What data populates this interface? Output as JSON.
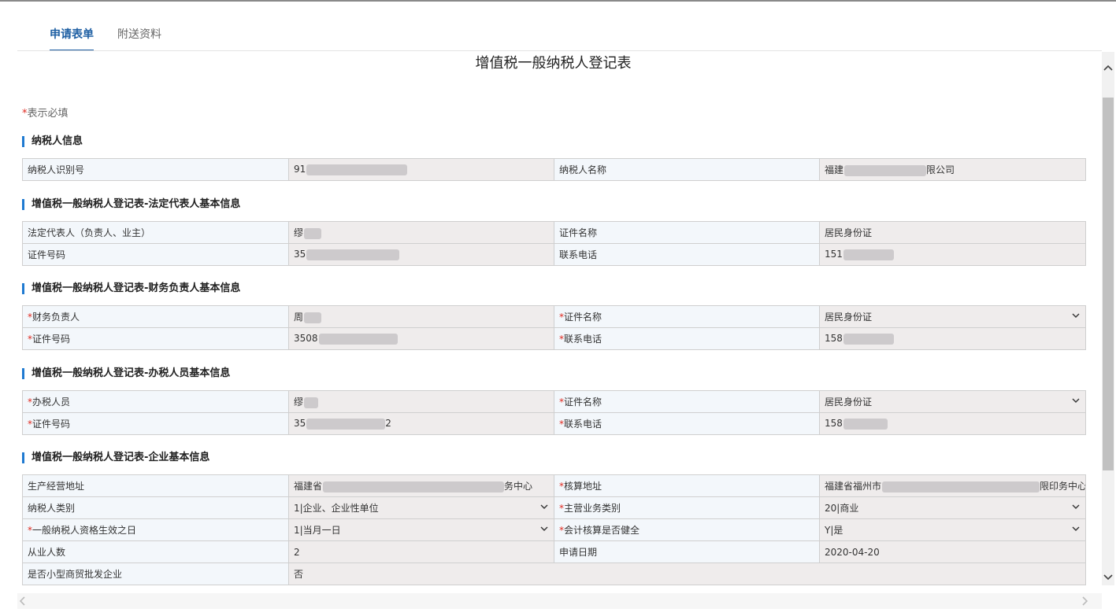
{
  "tabs": [
    {
      "label": "申请表单",
      "active": true
    },
    {
      "label": "附送资料",
      "active": false
    }
  ],
  "form_title": "增值税一般纳税人登记表",
  "required_note": "表示必填",
  "required_star": "*",
  "sections": {
    "taxpayer": {
      "title": "纳税人信息",
      "fields": {
        "tax_id_label": "纳税人识别号",
        "tax_id_value": "91",
        "name_label": "纳税人名称",
        "name_prefix": "福建",
        "name_suffix": "限公司"
      }
    },
    "legal": {
      "title": "增值税一般纳税人登记表-法定代表人基本信息",
      "fields": {
        "rep_label": "法定代表人（负责人、业主）",
        "rep_value": "缪",
        "cert_name_label": "证件名称",
        "cert_name_value": "居民身份证",
        "cert_no_label": "证件号码",
        "cert_no_value": "35",
        "phone_label": "联系电话",
        "phone_value": "151"
      }
    },
    "finance": {
      "title": "增值税一般纳税人登记表-财务负责人基本信息",
      "fields": {
        "person_label": "财务负责人",
        "person_value": "周",
        "cert_name_label": "证件名称",
        "cert_name_value": "居民身份证",
        "cert_no_label": "证件号码",
        "cert_no_value": "3508",
        "phone_label": "联系电话",
        "phone_value": "158"
      }
    },
    "tax_staff": {
      "title": "增值税一般纳税人登记表-办税人员基本信息",
      "fields": {
        "person_label": "办税人员",
        "person_value": "缪",
        "cert_name_label": "证件名称",
        "cert_name_value": "居民身份证",
        "cert_no_label": "证件号码",
        "cert_no_value": "35",
        "cert_no_suffix": "2",
        "phone_label": "联系电话",
        "phone_value": "158"
      }
    },
    "enterprise": {
      "title": "增值税一般纳税人登记表-企业基本信息",
      "fields": {
        "biz_addr_label": "生产经营地址",
        "biz_addr_prefix": "福建省",
        "biz_addr_suffix": "务中心",
        "acct_addr_label": "核算地址",
        "acct_addr_prefix": "福建省福州市",
        "acct_addr_suffix": "限印务中心",
        "taxpayer_type_label": "纳税人类别",
        "taxpayer_type_value": "1|企业、企业性单位",
        "main_biz_label": "主营业务类别",
        "main_biz_value": "20|商业",
        "effective_label": "一般纳税人资格生效之日",
        "effective_value": "1|当月一日",
        "acct_sound_label": "会计核算是否健全",
        "acct_sound_value": "Y|是",
        "employees_label": "从业人数",
        "employees_value": "2",
        "apply_date_label": "申请日期",
        "apply_date_value": "2020-04-20",
        "small_trade_label": "是否小型商贸批发企业",
        "small_trade_value": "否"
      }
    }
  },
  "colors": {
    "accent": "#1e5fa3",
    "section_bar": "#1f7ad1",
    "required": "#e0291f",
    "label_bg": "#f3f7fb",
    "value_bg": "#efecec"
  },
  "icons": [
    "chevron-down-icon",
    "scroll-up-icon",
    "scroll-down-icon",
    "scroll-left-icon",
    "scroll-right-icon"
  ]
}
